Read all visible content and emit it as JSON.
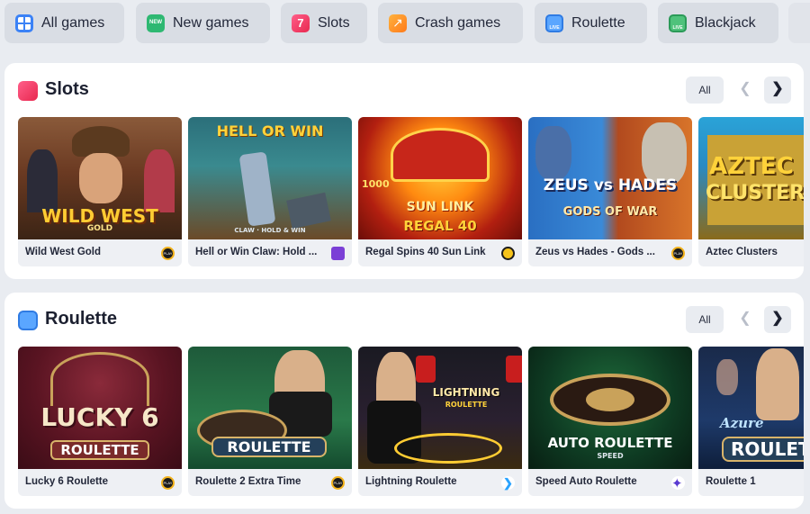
{
  "categories": [
    {
      "label": "All games",
      "icon": "grid-icon"
    },
    {
      "label": "New games",
      "icon": "new-badge-icon"
    },
    {
      "label": "Slots",
      "icon": "slot-machine-icon"
    },
    {
      "label": "Crash games",
      "icon": "rocket-icon"
    },
    {
      "label": "Roulette",
      "icon": "live-roulette-icon"
    },
    {
      "label": "Blackjack",
      "icon": "live-blackjack-icon"
    }
  ],
  "sections": [
    {
      "title": "Slots",
      "all_label": "All",
      "games": [
        {
          "name": "Wild West Gold",
          "art_text": "WILD WEST",
          "art_sub": "GOLD",
          "provider_icon": "pragmatic-play-icon"
        },
        {
          "name": "Hell or Win Claw: Hold ...",
          "art_text": "HELL OR WIN",
          "art_sub": "CLAW · HOLD & WIN",
          "provider_icon": "purple-crown-provider-icon"
        },
        {
          "name": "Regal Spins 40 Sun Link",
          "art_text": "SUN LINK",
          "art_sub": "REGAL 40",
          "art_extra": "1000",
          "provider_icon": "yellow-provider-icon"
        },
        {
          "name": "Zeus vs Hades - Gods ...",
          "art_text": "ZEUS vs HADES",
          "art_sub": "GODS OF WAR",
          "provider_icon": "pragmatic-play-icon"
        },
        {
          "name": "Aztec Clusters",
          "art_text": "AZTEC",
          "art_sub": "CLUSTERS",
          "provider_icon": ""
        }
      ]
    },
    {
      "title": "Roulette",
      "all_label": "All",
      "games": [
        {
          "name": "Lucky 6 Roulette",
          "art_text": "LUCKY 6",
          "art_sub": "ROULETTE",
          "provider_icon": "pragmatic-play-icon"
        },
        {
          "name": "Roulette 2 Extra Time",
          "art_text": "ROULETTE",
          "art_sub": "",
          "provider_icon": "pragmatic-play-icon"
        },
        {
          "name": "Lightning Roulette",
          "art_text": "LIGHTNING",
          "art_sub": "ROULETTE",
          "provider_icon": "evolution-chevron-icon"
        },
        {
          "name": "Speed Auto Roulette",
          "art_text": "AUTO ROULETTE",
          "art_sub": "SPEED",
          "provider_icon": "four-petal-provider-icon"
        },
        {
          "name": "Roulette 1",
          "art_text": "Azure",
          "art_sub": "ROULETTE",
          "provider_icon": ""
        }
      ]
    }
  ],
  "colors": {
    "accent": "#3b82f6",
    "panel_bg": "#ffffff",
    "page_bg": "#e9ecf1"
  }
}
